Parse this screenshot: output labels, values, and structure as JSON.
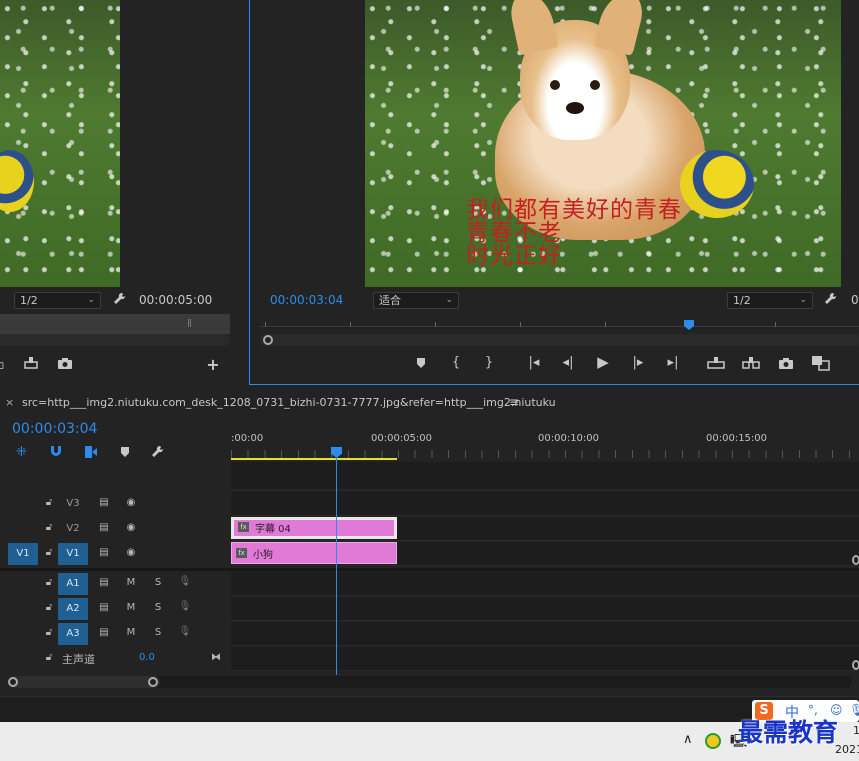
{
  "source_monitor": {
    "resolution": "1/2",
    "timecode": "00:00:05:00"
  },
  "program_monitor": {
    "overlay_lines": [
      "我们都有美好的青春",
      "青春不老",
      "时光正好"
    ],
    "timecode": "00:00:03:04",
    "fit": "适合",
    "resolution": "1/2"
  },
  "timeline": {
    "sequence_name": "src=http___img2.niutuku.com_desk_1208_0731_bizhi-0731-7777.jpg&refer=http___img2.niutuku",
    "current_time": "00:00:03:04",
    "ruler_labels": [
      ":00:00",
      "00:00:05:00",
      "00:00:10:00",
      "00:00:15:00"
    ],
    "video_tracks": [
      {
        "name": "V3",
        "source": ""
      },
      {
        "name": "V2",
        "source": ""
      },
      {
        "name": "V1",
        "source": "V1"
      }
    ],
    "audio_tracks": [
      {
        "name": "A1",
        "m": "M",
        "s": "S"
      },
      {
        "name": "A2",
        "m": "M",
        "s": "S"
      },
      {
        "name": "A3",
        "m": "M",
        "s": "S"
      }
    ],
    "master": {
      "label": "主声道",
      "value": "0.0"
    },
    "clips": [
      {
        "track": "V2",
        "label": "字幕 04"
      },
      {
        "track": "V1",
        "label": "小狗"
      }
    ]
  },
  "watermark": "最需教育",
  "taskbar": {
    "ime": "中",
    "clock_partial": "1",
    "year_partial": "2021"
  },
  "colors": {
    "accent_blue": "#2d8ceb",
    "clip_pink": "#e07ad6",
    "overlay_red": "#c42020",
    "work_area_yellow": "#e8e030"
  }
}
